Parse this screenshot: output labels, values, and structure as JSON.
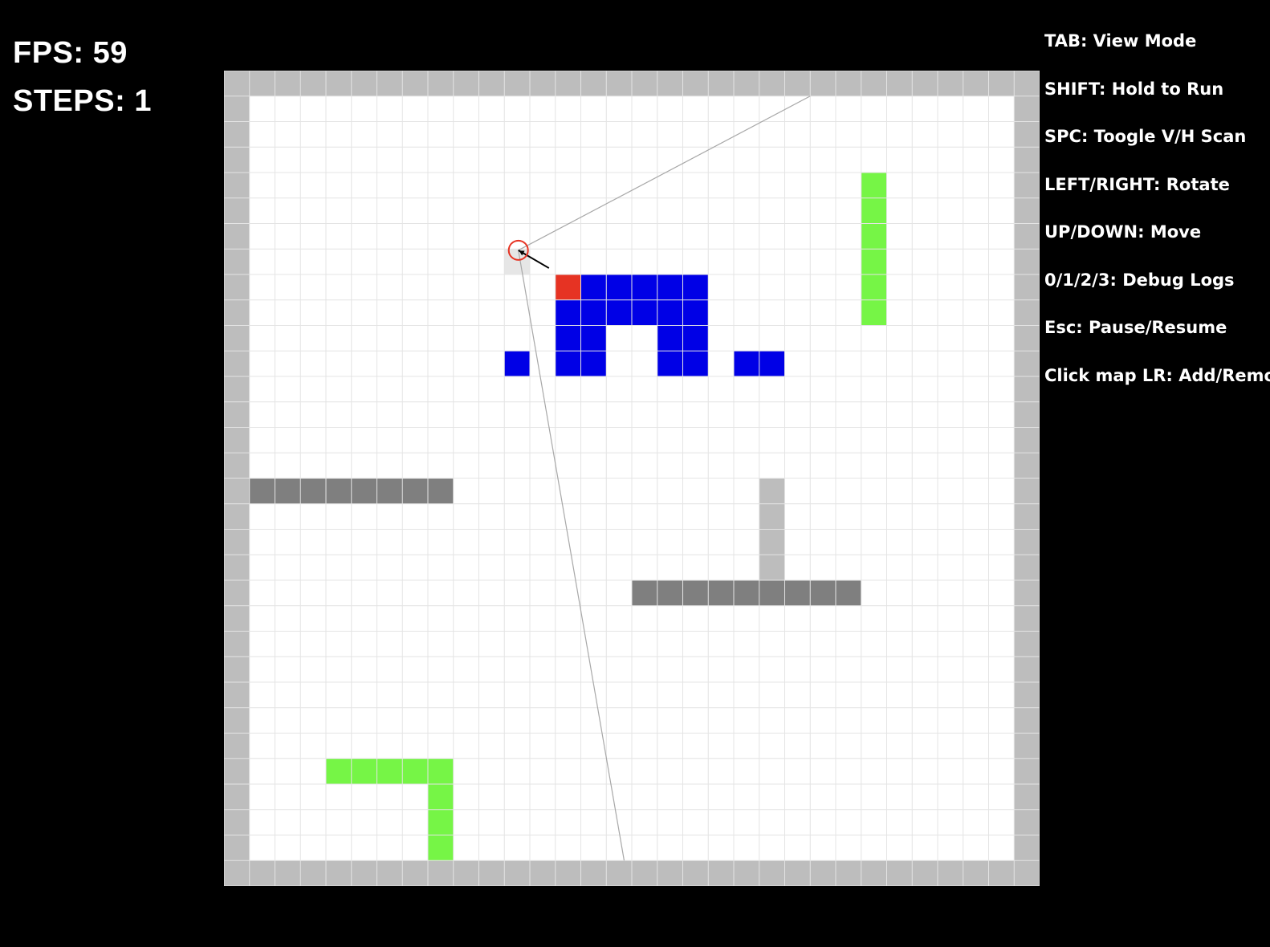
{
  "hud": {
    "fps_label": "FPS:",
    "fps_value": "59",
    "steps_label": "STEPS:",
    "steps_value": "1"
  },
  "controls": [
    {
      "key": "TAB",
      "action": "View Mode"
    },
    {
      "key": "SHIFT",
      "action": "Hold to Run"
    },
    {
      "key": "SPC",
      "action": "Toogle V/H Scan"
    },
    {
      "key": "LEFT/RIGHT",
      "action": "Rotate"
    },
    {
      "key": "UP/DOWN",
      "action": "Move"
    },
    {
      "key": "0/1/2/3",
      "action": "Debug Logs"
    },
    {
      "key": "Esc",
      "action": "Pause/Resume"
    },
    {
      "key": "Click map LR",
      "action": "Add/Remove"
    }
  ],
  "map": {
    "cols": 32,
    "rows": 32,
    "colors": {
      "floor": "#ffffff",
      "gridline": "#e4e4e4",
      "border_wall": "#bdbdbd",
      "light_wall": "#bdbdbd",
      "dark_wall": "#7f7f7f",
      "green_wall": "#76f546",
      "blue_wall": "#0000e6",
      "hit_cell": "#e63323",
      "player_cell": "#e6e6e6",
      "player_circle": "#e63323",
      "ray": "#a8a8a8",
      "direction": "#000000"
    },
    "cells": {
      "dark_wall": [
        [
          1,
          16
        ],
        [
          2,
          16
        ],
        [
          3,
          16
        ],
        [
          4,
          16
        ],
        [
          5,
          16
        ],
        [
          6,
          16
        ],
        [
          7,
          16
        ],
        [
          8,
          16
        ],
        [
          16,
          20
        ],
        [
          17,
          20
        ],
        [
          18,
          20
        ],
        [
          19,
          20
        ],
        [
          20,
          20
        ],
        [
          21,
          20
        ],
        [
          22,
          20
        ],
        [
          23,
          20
        ],
        [
          24,
          20
        ]
      ],
      "light_wall": [
        [
          21,
          16
        ],
        [
          21,
          17
        ],
        [
          21,
          18
        ],
        [
          21,
          19
        ]
      ],
      "green_wall": [
        [
          25,
          4
        ],
        [
          25,
          5
        ],
        [
          25,
          6
        ],
        [
          25,
          7
        ],
        [
          25,
          8
        ],
        [
          25,
          9
        ],
        [
          4,
          27
        ],
        [
          5,
          27
        ],
        [
          6,
          27
        ],
        [
          7,
          27
        ],
        [
          8,
          27
        ],
        [
          8,
          28
        ],
        [
          8,
          29
        ],
        [
          8,
          30
        ]
      ],
      "blue_wall": [
        [
          14,
          8
        ],
        [
          15,
          8
        ],
        [
          16,
          8
        ],
        [
          17,
          8
        ],
        [
          18,
          8
        ],
        [
          13,
          9
        ],
        [
          14,
          9
        ],
        [
          15,
          9
        ],
        [
          16,
          9
        ],
        [
          17,
          9
        ],
        [
          18,
          9
        ],
        [
          13,
          10
        ],
        [
          14,
          10
        ],
        [
          17,
          10
        ],
        [
          18,
          10
        ],
        [
          11,
          11
        ],
        [
          13,
          11
        ],
        [
          14,
          11
        ],
        [
          17,
          11
        ],
        [
          18,
          11
        ],
        [
          20,
          11
        ],
        [
          21,
          11
        ]
      ],
      "hit_cell": [
        [
          13,
          8
        ]
      ]
    },
    "player": {
      "col": 11.55,
      "row": 7.05,
      "cell": [
        11,
        7
      ]
    },
    "rays": [
      {
        "to_col": 23.0,
        "to_row": 1.0
      },
      {
        "to_col": 15.7,
        "to_row": 31.0
      }
    ],
    "direction": {
      "to_col": 12.75,
      "to_row": 7.75
    }
  }
}
